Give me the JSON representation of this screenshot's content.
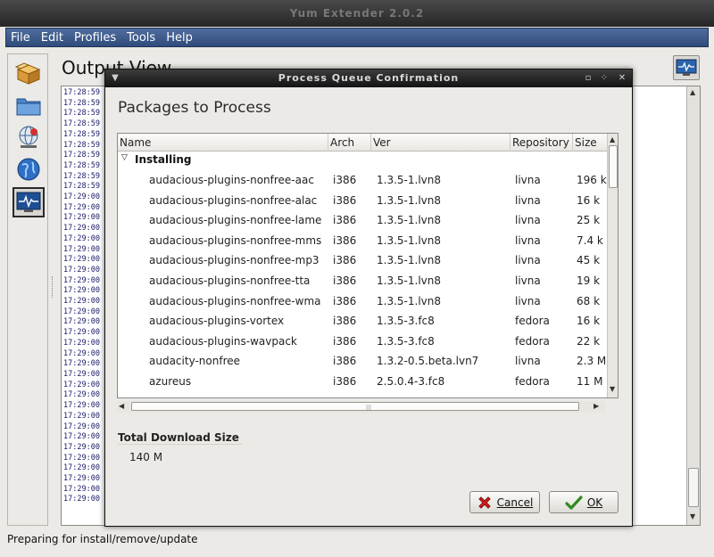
{
  "main_window": {
    "title": "Yum Extender 2.0.2",
    "menu": [
      "File",
      "Edit",
      "Profiles",
      "Tools",
      "Help"
    ],
    "view_title": "Output View",
    "log_lines": [
      "17:28:59",
      "17:28:59",
      "17:28:59",
      "17:28:59",
      "17:28:59",
      "17:28:59",
      "17:28:59",
      "17:28:59",
      "17:28:59",
      "17:28:59",
      "17:29:00",
      "17:29:00",
      "17:29:00",
      "17:29:00",
      "17:29:00",
      "17:29:00",
      "17:29:00",
      "17:29:00",
      "17:29:00",
      "17:29:00",
      "17:29:00",
      "17:29:00",
      "17:29:00",
      "17:29:00",
      "17:29:00",
      "17:29:00",
      "17:29:00",
      "17:29:00",
      "17:29:00",
      "17:29:00",
      "17:29:00",
      "17:29:00",
      "17:29:00",
      "17:29:00",
      "17:29:00",
      "17:29:00",
      "17:29:00",
      "17:29:00",
      "17:29:00",
      "17:29:00"
    ],
    "status": "Preparing for install/remove/update"
  },
  "dialog": {
    "title": "Process Queue Confirmation",
    "heading": "Packages to Process",
    "columns": [
      "Name",
      "Arch",
      "Ver",
      "Repository",
      "Size"
    ],
    "group": "Installing",
    "rows": [
      {
        "name": "audacious-plugins-nonfree-aac",
        "arch": "i386",
        "ver": "1.3.5-1.lvn8",
        "repo": "livna",
        "size": "196 k"
      },
      {
        "name": "audacious-plugins-nonfree-alac",
        "arch": "i386",
        "ver": "1.3.5-1.lvn8",
        "repo": "livna",
        "size": "16 k"
      },
      {
        "name": "audacious-plugins-nonfree-lame",
        "arch": "i386",
        "ver": "1.3.5-1.lvn8",
        "repo": "livna",
        "size": "25 k"
      },
      {
        "name": "audacious-plugins-nonfree-mms",
        "arch": "i386",
        "ver": "1.3.5-1.lvn8",
        "repo": "livna",
        "size": "7.4 k"
      },
      {
        "name": "audacious-plugins-nonfree-mp3",
        "arch": "i386",
        "ver": "1.3.5-1.lvn8",
        "repo": "livna",
        "size": "45 k"
      },
      {
        "name": "audacious-plugins-nonfree-tta",
        "arch": "i386",
        "ver": "1.3.5-1.lvn8",
        "repo": "livna",
        "size": "19 k"
      },
      {
        "name": "audacious-plugins-nonfree-wma",
        "arch": "i386",
        "ver": "1.3.5-1.lvn8",
        "repo": "livna",
        "size": "68 k"
      },
      {
        "name": "audacious-plugins-vortex",
        "arch": "i386",
        "ver": "1.3.5-3.fc8",
        "repo": "fedora",
        "size": "16 k"
      },
      {
        "name": "audacious-plugins-wavpack",
        "arch": "i386",
        "ver": "1.3.5-3.fc8",
        "repo": "fedora",
        "size": "22 k"
      },
      {
        "name": "audacity-nonfree",
        "arch": "i386",
        "ver": "1.3.2-0.5.beta.lvn7",
        "repo": "livna",
        "size": "2.3 M"
      },
      {
        "name": "azureus",
        "arch": "i386",
        "ver": "2.5.0.4-3.fc8",
        "repo": "fedora",
        "size": "11 M"
      }
    ],
    "download_label": "Total Download Size",
    "download_value": "140 M",
    "cancel_label": "Cancel",
    "ok_label": "OK"
  },
  "icons": {
    "sidebar": [
      "package-box-icon",
      "folder-icon",
      "globe-network-icon",
      "globe-icon",
      "monitor-icon"
    ],
    "cancel": "red-x-icon",
    "ok": "green-check-icon"
  }
}
